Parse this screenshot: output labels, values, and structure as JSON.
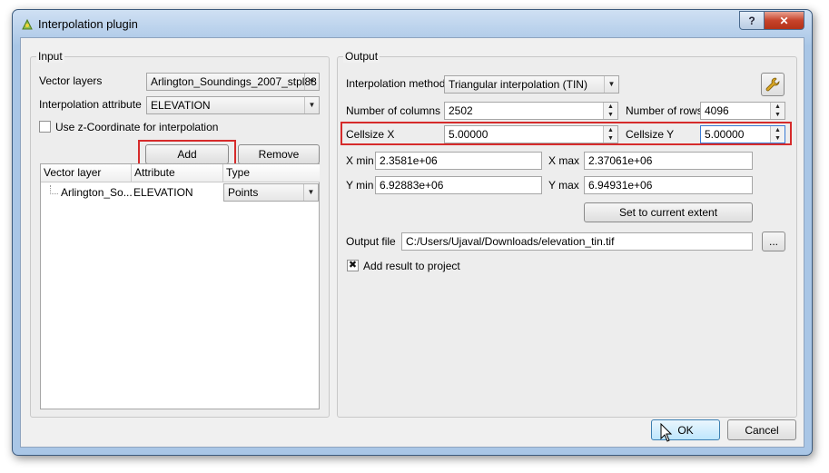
{
  "window": {
    "title": "Interpolation plugin",
    "help_label": "?",
    "close_label": "✕"
  },
  "input": {
    "group_title": "Input",
    "vector_layers_label": "Vector layers",
    "vector_layers_value": "Arlington_Soundings_2007_stpl83",
    "interp_attr_label": "Interpolation attribute",
    "interp_attr_value": "ELEVATION",
    "use_z_label": "Use z-Coordinate for interpolation",
    "use_z_checked": false,
    "add_label": "Add",
    "remove_label": "Remove",
    "table": {
      "headers": [
        "Vector layer",
        "Attribute",
        "Type"
      ],
      "rows": [
        {
          "layer": "Arlington_So...",
          "attribute": "ELEVATION",
          "type": "Points"
        }
      ]
    }
  },
  "output": {
    "group_title": "Output",
    "method_label": "Interpolation method",
    "method_value": "Triangular interpolation (TIN)",
    "columns_label": "Number of columns",
    "columns_value": "2502",
    "rows_label": "Number of rows",
    "rows_value": "4096",
    "cellsize_x_label": "Cellsize X",
    "cellsize_x_value": "5.00000",
    "cellsize_y_label": "Cellsize Y",
    "cellsize_y_value": "5.00000",
    "xmin_label": "X min",
    "xmin_value": "2.3581e+06",
    "xmax_label": "X max",
    "xmax_value": "2.37061e+06",
    "ymin_label": "Y min",
    "ymin_value": "6.92883e+06",
    "ymax_label": "Y max",
    "ymax_value": "6.94931e+06",
    "set_extent_label": "Set to current extent",
    "output_file_label": "Output file",
    "output_file_value": "C:/Users/Ujaval/Downloads/elevation_tin.tif",
    "browse_label": "...",
    "add_result_label": "Add result to project",
    "add_result_checked": true
  },
  "footer": {
    "ok_label": "OK",
    "cancel_label": "Cancel"
  },
  "colors": {
    "highlight": "#d62b2b",
    "accent": "#3c7fb1"
  },
  "icons": {
    "title": "qgis-plugin-icon",
    "settings": "wrench-icon",
    "checkbox_checked": "x-check-mark"
  }
}
